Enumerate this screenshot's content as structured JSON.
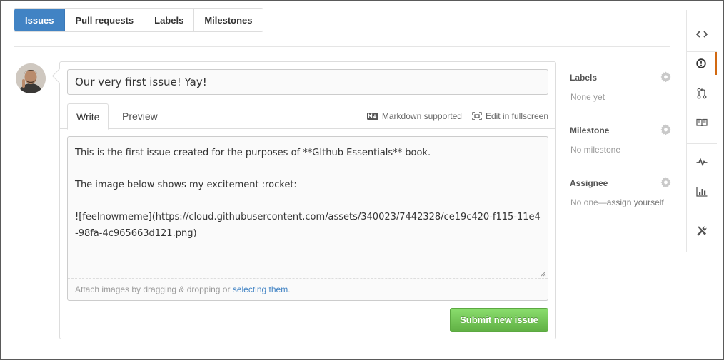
{
  "subnav": {
    "tabs": [
      {
        "label": "Issues",
        "active": true
      },
      {
        "label": "Pull requests",
        "active": false
      },
      {
        "label": "Labels",
        "active": false
      },
      {
        "label": "Milestones",
        "active": false
      }
    ]
  },
  "composer": {
    "title_value": "Our very first issue! Yay!",
    "tabs": {
      "write": "Write",
      "preview": "Preview"
    },
    "toolbar": {
      "markdown": "Markdown supported",
      "fullscreen": "Edit in fullscreen"
    },
    "body_value": "This is the first issue created for the purposes of **GIthub Essentials** book.\n\nThe image below shows my excitement :rocket:\n\n![feelnowmeme](https://cloud.githubusercontent.com/assets/340023/7442328/ce19c420-f115-11e4-98fa-4c965663d121.png)",
    "attach": {
      "prefix": "Attach images by dragging & dropping or ",
      "link": "selecting them",
      "suffix": "."
    },
    "submit_label": "Submit new issue"
  },
  "sidebar": {
    "labels": {
      "heading": "Labels",
      "value": "None yet"
    },
    "milestone": {
      "heading": "Milestone",
      "value": "No milestone"
    },
    "assignee": {
      "heading": "Assignee",
      "value_prefix": "No one—",
      "value_link": "assign yourself"
    }
  },
  "rail": {
    "items": [
      {
        "icon": "code-icon"
      },
      {
        "icon": "issue-opened-icon",
        "active": true
      },
      {
        "icon": "git-pull-request-icon"
      },
      {
        "icon": "book-icon"
      },
      {
        "icon": "pulse-icon"
      },
      {
        "icon": "graph-icon"
      },
      {
        "icon": "tools-icon"
      }
    ]
  },
  "colors": {
    "accent": "#4183c4",
    "submit": "#60b044",
    "rail_active": "#d26911"
  }
}
